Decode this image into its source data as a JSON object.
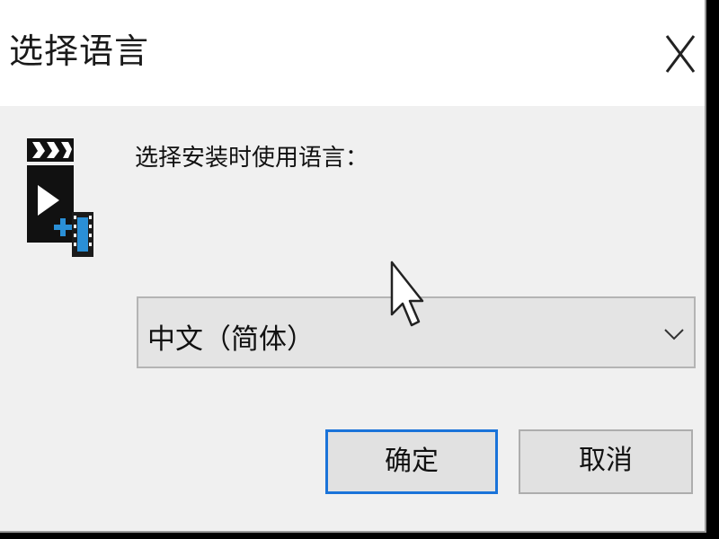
{
  "dialog": {
    "title": "选择语言",
    "prompt": "选择安装时使用语言：",
    "language_select": {
      "selected": "中文（简体）"
    },
    "ok_label": "确定",
    "cancel_label": "取消"
  },
  "icons": {
    "close": "close-icon",
    "app": "video-clapper-icon",
    "dropdown": "chevron-down-icon",
    "cursor": "mouse-pointer"
  },
  "colors": {
    "title_bg": "#ffffff",
    "dialog_bg": "#f0f0f0",
    "focus_border": "#1a73d9",
    "icon_accent": "#2a8fd6"
  }
}
